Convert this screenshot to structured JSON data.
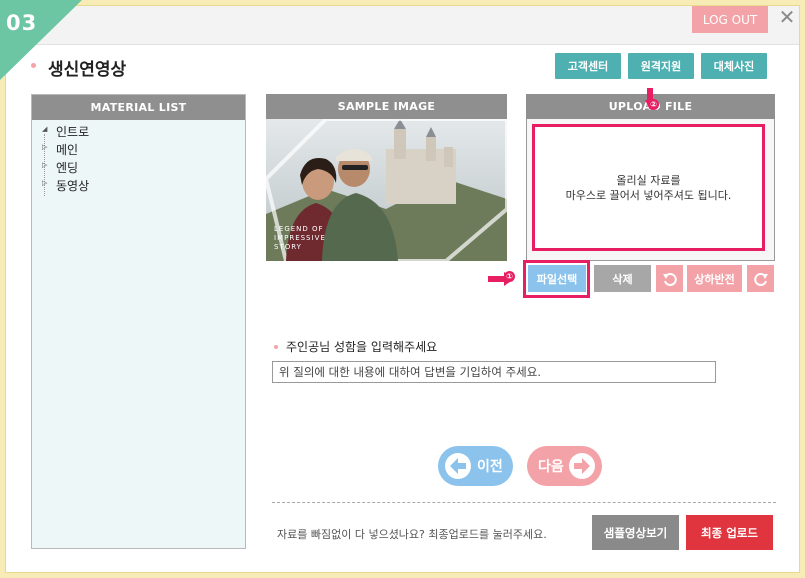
{
  "step": {
    "number": "03"
  },
  "header": {
    "logout_label": "LOG OUT",
    "close_glyph": "✕"
  },
  "page": {
    "title": "생신연영상"
  },
  "top_buttons": {
    "support": "고객센터",
    "remote": "원격지원",
    "replace_photo": "대체사진"
  },
  "material_list": {
    "header": "MATERIAL LIST",
    "items": [
      {
        "label": "인트로",
        "expanded": true
      },
      {
        "label": "메인",
        "expanded": false
      },
      {
        "label": "엔딩",
        "expanded": false
      },
      {
        "label": "동영상",
        "expanded": false
      }
    ]
  },
  "sample": {
    "header": "SAMPLE IMAGE",
    "overlay_text": [
      "LEGEND OF",
      "IMPRESSIVE",
      "STORY"
    ]
  },
  "upload": {
    "header": "UPLOAD FILE",
    "drop_line1": "올리실 자료를",
    "drop_line2": "마우스로 끌어서 넣어주셔도 됩니다.",
    "step_badge": "②"
  },
  "actions": {
    "file_select": "파일선택",
    "delete": "삭제",
    "flip": "상하반전",
    "step_badge": "①"
  },
  "question": {
    "label": "주인공님 성함을 입력해주세요",
    "value": "위 질의에 대한 내용에 대하여 답변을 기입하여 주세요."
  },
  "nav": {
    "prev": "이전",
    "next": "다음"
  },
  "footer": {
    "notice": "자료를 빠짐없이 다 넣으셨나요? 최종업로드를 눌러주세요.",
    "preview": "샘플영상보기",
    "final_upload": "최종 업로드"
  },
  "colors": {
    "step_green": "#6cc5a3",
    "teal": "#4fb0b2",
    "pink_accent": "#e81e63",
    "pink_light": "#f3a2a7",
    "blue": "#8cc3ec",
    "final_red": "#e0353e"
  }
}
